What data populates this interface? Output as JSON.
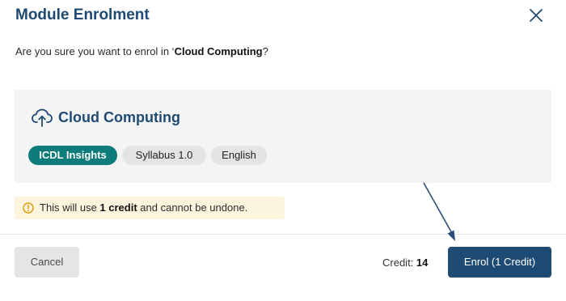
{
  "dialog": {
    "title": "Module Enrolment",
    "close_icon": "close-icon"
  },
  "prompt": {
    "prefix": "Are you sure you want to enrol in ‘",
    "module": "Cloud Computing",
    "suffix": "?"
  },
  "module_card": {
    "icon": "cloud-upload-icon",
    "name": "Cloud Computing",
    "tags": [
      "ICDL Insights",
      "Syllabus 1.0",
      "English"
    ]
  },
  "notice": {
    "icon": "warning-icon",
    "prefix": "This will use ",
    "credit_text": "1 credit",
    "suffix": " and cannot be undone."
  },
  "footer": {
    "cancel_label": "Cancel",
    "credit_label": "Credit: ",
    "credit_value": "14",
    "enrol_label": "Enrol (1 Credit)"
  },
  "colors": {
    "primary": "#1e4b74",
    "brand_tag": "#0f7c7c",
    "notice_bg": "#fdf4de",
    "card_bg": "#f4f4f5"
  }
}
